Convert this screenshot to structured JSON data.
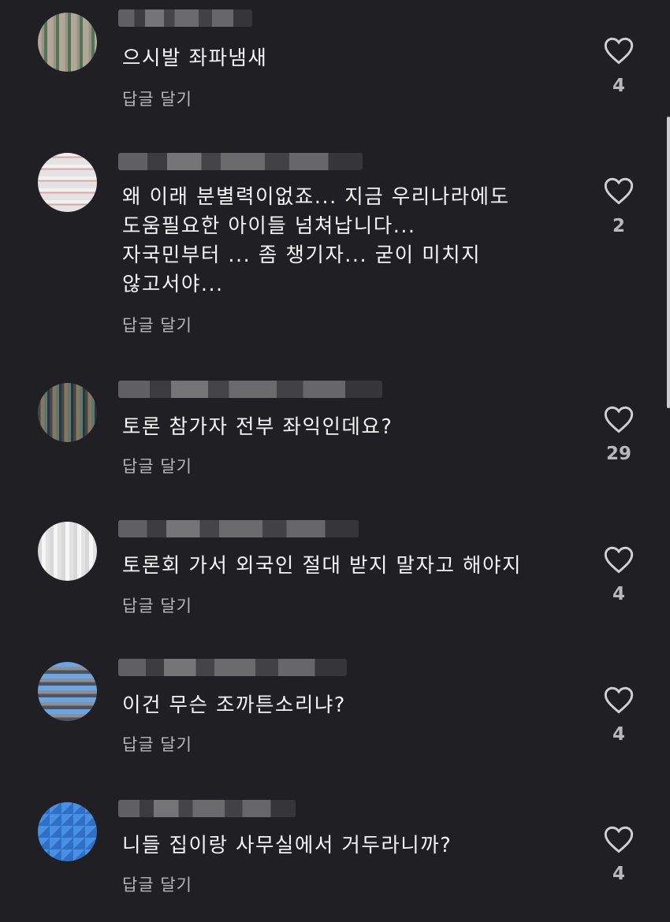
{
  "comments": [
    {
      "text": "으시발 좌파냄새",
      "reply": "답글 달기",
      "likes": "4"
    },
    {
      "text": "왜 이래 분별력이없죠... 지금 우리나라에도\n도움필요한 아이들 넘쳐납니다...\n자국민부터 ... 좀 챙기자... 굳이 미치지\n않고서야...",
      "reply": "답글 달기",
      "likes": "2"
    },
    {
      "text": "토론 참가자 전부 좌익인데요?",
      "reply": "답글 달기",
      "likes": "29"
    },
    {
      "text": "토론회 가서 외국인 절대 받지 말자고 해야지",
      "reply": "답글 달기",
      "likes": "4"
    },
    {
      "text": "이건 무슨 조까튼소리냐?",
      "reply": "답글 달기",
      "likes": "4"
    },
    {
      "text": "니들 집이랑 사무실에서 거두라니까?",
      "reply": "답글 달기",
      "likes": "4"
    }
  ],
  "icons": {
    "like": "heart-outline-icon"
  },
  "colors": {
    "background": "#1f1f24",
    "text": "#f4f4f4",
    "muted": "#b7b7bb"
  }
}
